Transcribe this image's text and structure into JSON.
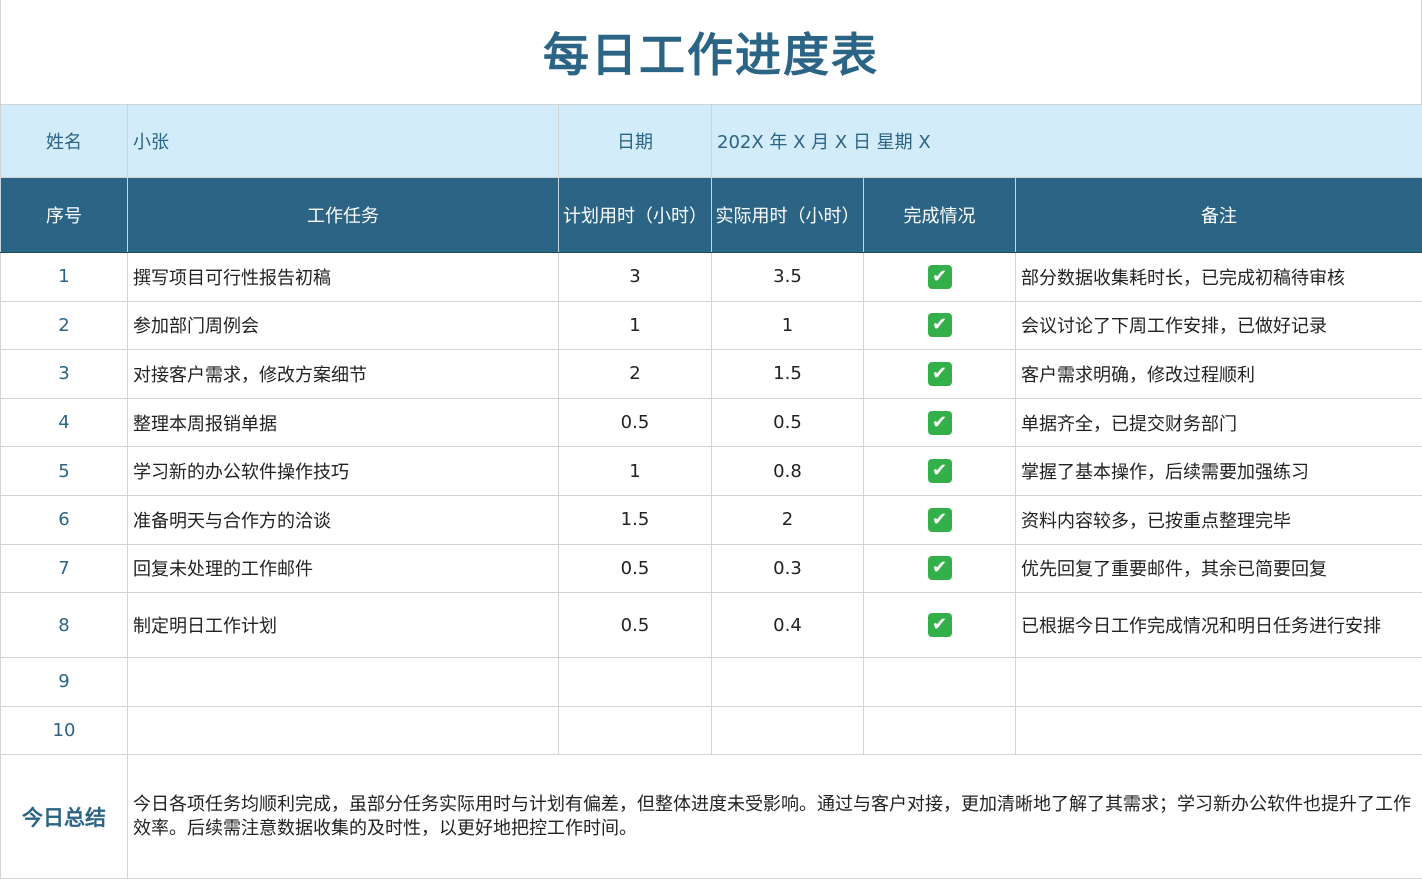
{
  "title": "每日工作进度表",
  "info": {
    "name_label": "姓名",
    "name_value": "小张",
    "date_label": "日期",
    "date_value": "202X 年 X 月 X 日  星期 X"
  },
  "headers": {
    "index": "序号",
    "task": "工作任务",
    "planned": "计划用时（小时）",
    "actual": "实际用时（小时）",
    "status": "完成情况",
    "note": "备注"
  },
  "rows": [
    {
      "index": "1",
      "task": "撰写项目可行性报告初稿",
      "planned": "3",
      "actual": "3.5",
      "done": true,
      "note": "部分数据收集耗时长，已完成初稿待审核"
    },
    {
      "index": "2",
      "task": "参加部门周例会",
      "planned": "1",
      "actual": "1",
      "done": true,
      "note": "会议讨论了下周工作安排，已做好记录"
    },
    {
      "index": "3",
      "task": "对接客户需求，修改方案细节",
      "planned": "2",
      "actual": "1.5",
      "done": true,
      "note": "客户需求明确，修改过程顺利"
    },
    {
      "index": "4",
      "task": "整理本周报销单据",
      "planned": "0.5",
      "actual": "0.5",
      "done": true,
      "note": "单据齐全，已提交财务部门"
    },
    {
      "index": "5",
      "task": "学习新的办公软件操作技巧",
      "planned": "1",
      "actual": "0.8",
      "done": true,
      "note": "掌握了基本操作，后续需要加强练习"
    },
    {
      "index": "6",
      "task": "准备明天与合作方的洽谈",
      "planned": "1.5",
      "actual": "2",
      "done": true,
      "note": "资料内容较多，已按重点整理完毕"
    },
    {
      "index": "7",
      "task": "回复未处理的工作邮件",
      "planned": "0.5",
      "actual": "0.3",
      "done": true,
      "note": "优先回复了重要邮件，其余已简要回复"
    },
    {
      "index": "8",
      "task": "制定明日工作计划",
      "planned": "0.5",
      "actual": "0.4",
      "done": true,
      "note": "已根据今日工作完成情况和明日任务进行安排"
    },
    {
      "index": "9",
      "task": "",
      "planned": "",
      "actual": "",
      "done": false,
      "note": ""
    },
    {
      "index": "10",
      "task": "",
      "planned": "",
      "actual": "",
      "done": false,
      "note": ""
    }
  ],
  "check_icon": "check-mark-icon",
  "summary": {
    "label": "今日总结",
    "text": "今日各项任务均顺利完成，虽部分任务实际用时与计划有偏差，但整体进度未受影响。通过与客户对接，更加清晰地了解了其需求；学习新办公软件也提升了工作效率。后续需注意数据收集的及时性，以更好地把控工作时间。"
  },
  "colors": {
    "title": "#2b6485",
    "header_bg": "#2b6485",
    "info_bg": "#d3ecf9",
    "check": "#34b04a"
  }
}
